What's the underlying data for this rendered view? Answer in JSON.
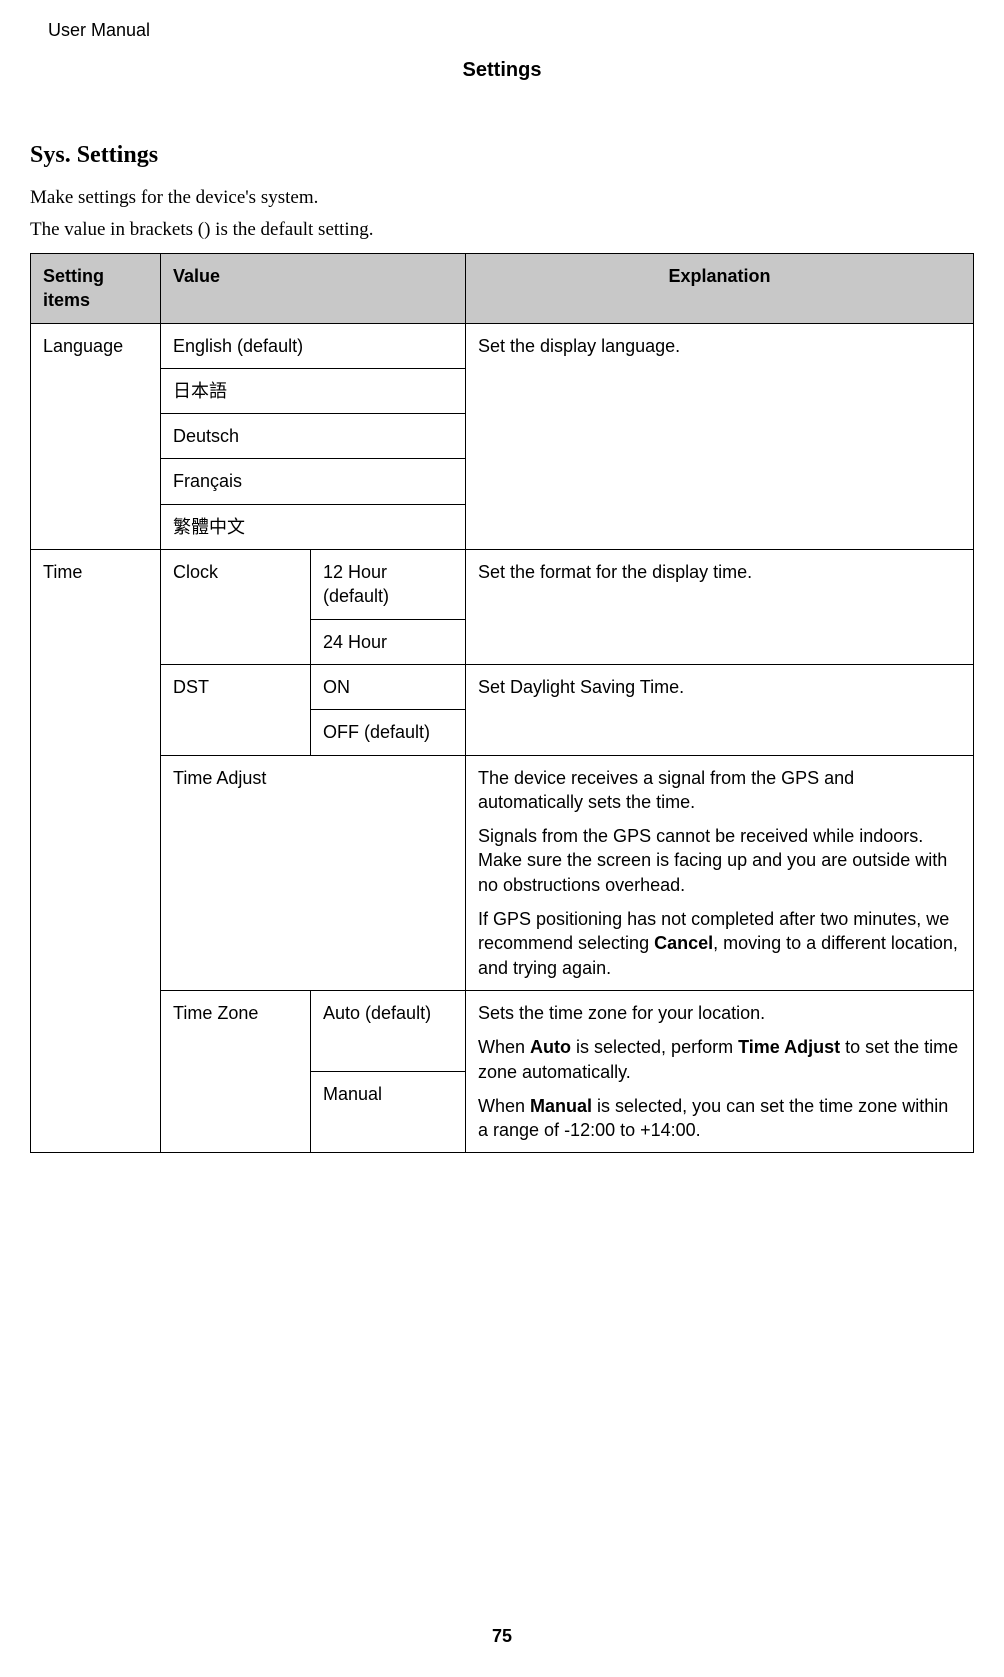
{
  "header": {
    "doc_title": "User Manual",
    "chapter": "Settings"
  },
  "section": {
    "heading": "Sys. Settings",
    "intro1": "Make settings for the device's system.",
    "intro2": "The value in brackets () is the default setting."
  },
  "table": {
    "head": {
      "col1": "Setting items",
      "col2": "Value",
      "col4": "Explanation"
    },
    "language": {
      "label": "Language",
      "values": {
        "v0": "English (default)",
        "v1": "日本語",
        "v2": "Deutsch",
        "v3": "Français",
        "v4": "繁體中文"
      },
      "explanation": "Set the display language."
    },
    "time": {
      "label": "Time",
      "clock": {
        "label": "Clock",
        "v0": "12 Hour (default)",
        "v1": "24 Hour",
        "explanation": "Set the format for the display time."
      },
      "dst": {
        "label": "DST",
        "v0": "ON",
        "v1": "OFF (default)",
        "explanation": "Set Daylight Saving Time."
      },
      "time_adjust": {
        "label": "Time Adjust",
        "p1": "The device receives a signal from the GPS and automatically sets the time.",
        "p2": "Signals from the GPS cannot be received while indoors. Make sure the screen is facing up and you are outside with no obstructions overhead.",
        "p3a": "If GPS positioning has not completed after two minutes, we recommend selecting ",
        "p3b": "Cancel",
        "p3c": ", moving to a different location, and trying again."
      },
      "time_zone": {
        "label": "Time Zone",
        "v0": "Auto (default)",
        "v1": "Manual",
        "p1": "Sets the time zone for your location.",
        "p2a": "When ",
        "p2b": "Auto",
        "p2c": " is selected, perform ",
        "p2d": "Time Adjust",
        "p2e": " to set the time zone automatically.",
        "p3a": "When ",
        "p3b": "Manual",
        "p3c": " is selected, you can set the time zone within a range of -12:00 to +14:00."
      }
    }
  },
  "page_number": "75"
}
